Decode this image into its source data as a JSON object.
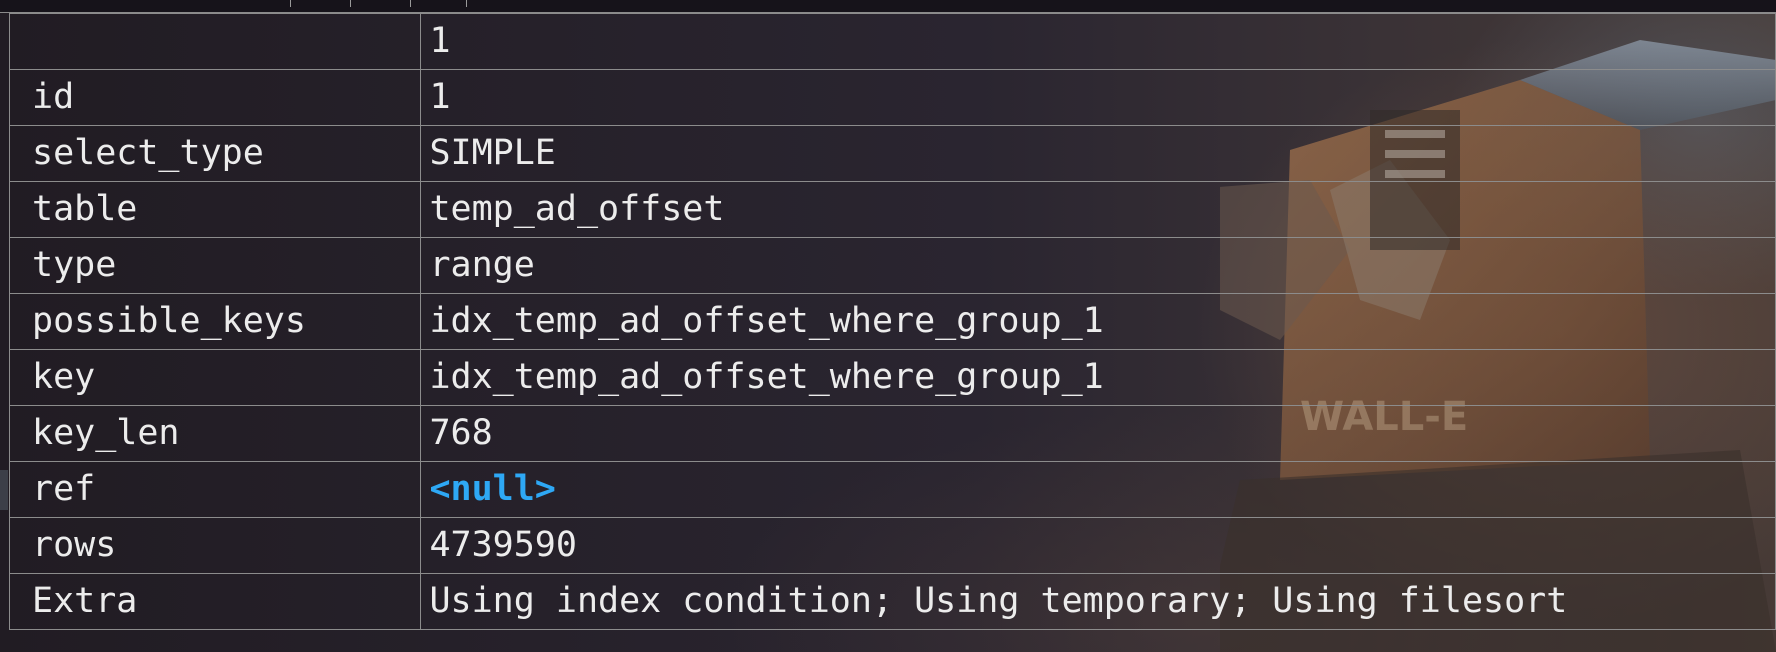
{
  "columns": {
    "header_value": "1"
  },
  "rows": [
    {
      "field": "id",
      "value": "1"
    },
    {
      "field": "select_type",
      "value": "SIMPLE"
    },
    {
      "field": "table",
      "value": "temp_ad_offset"
    },
    {
      "field": "type",
      "value": "range"
    },
    {
      "field": "possible_keys",
      "value": "idx_temp_ad_offset_where_group_1"
    },
    {
      "field": "key",
      "value": "idx_temp_ad_offset_where_group_1"
    },
    {
      "field": "key_len",
      "value": "768"
    },
    {
      "field": "ref",
      "value": "<null>"
    },
    {
      "field": "rows",
      "value": "4739590"
    },
    {
      "field": "Extra",
      "value": "Using index condition; Using temporary; Using filesort"
    }
  ],
  "background": {
    "wallpaper_icon": "wall-e-robot-wallpaper",
    "robot_label": "WALL-E"
  },
  "colors": {
    "text": "#ececec",
    "null_value": "#2ea8f5",
    "grid_line": "#8c8c8c",
    "background": "#211c23"
  }
}
